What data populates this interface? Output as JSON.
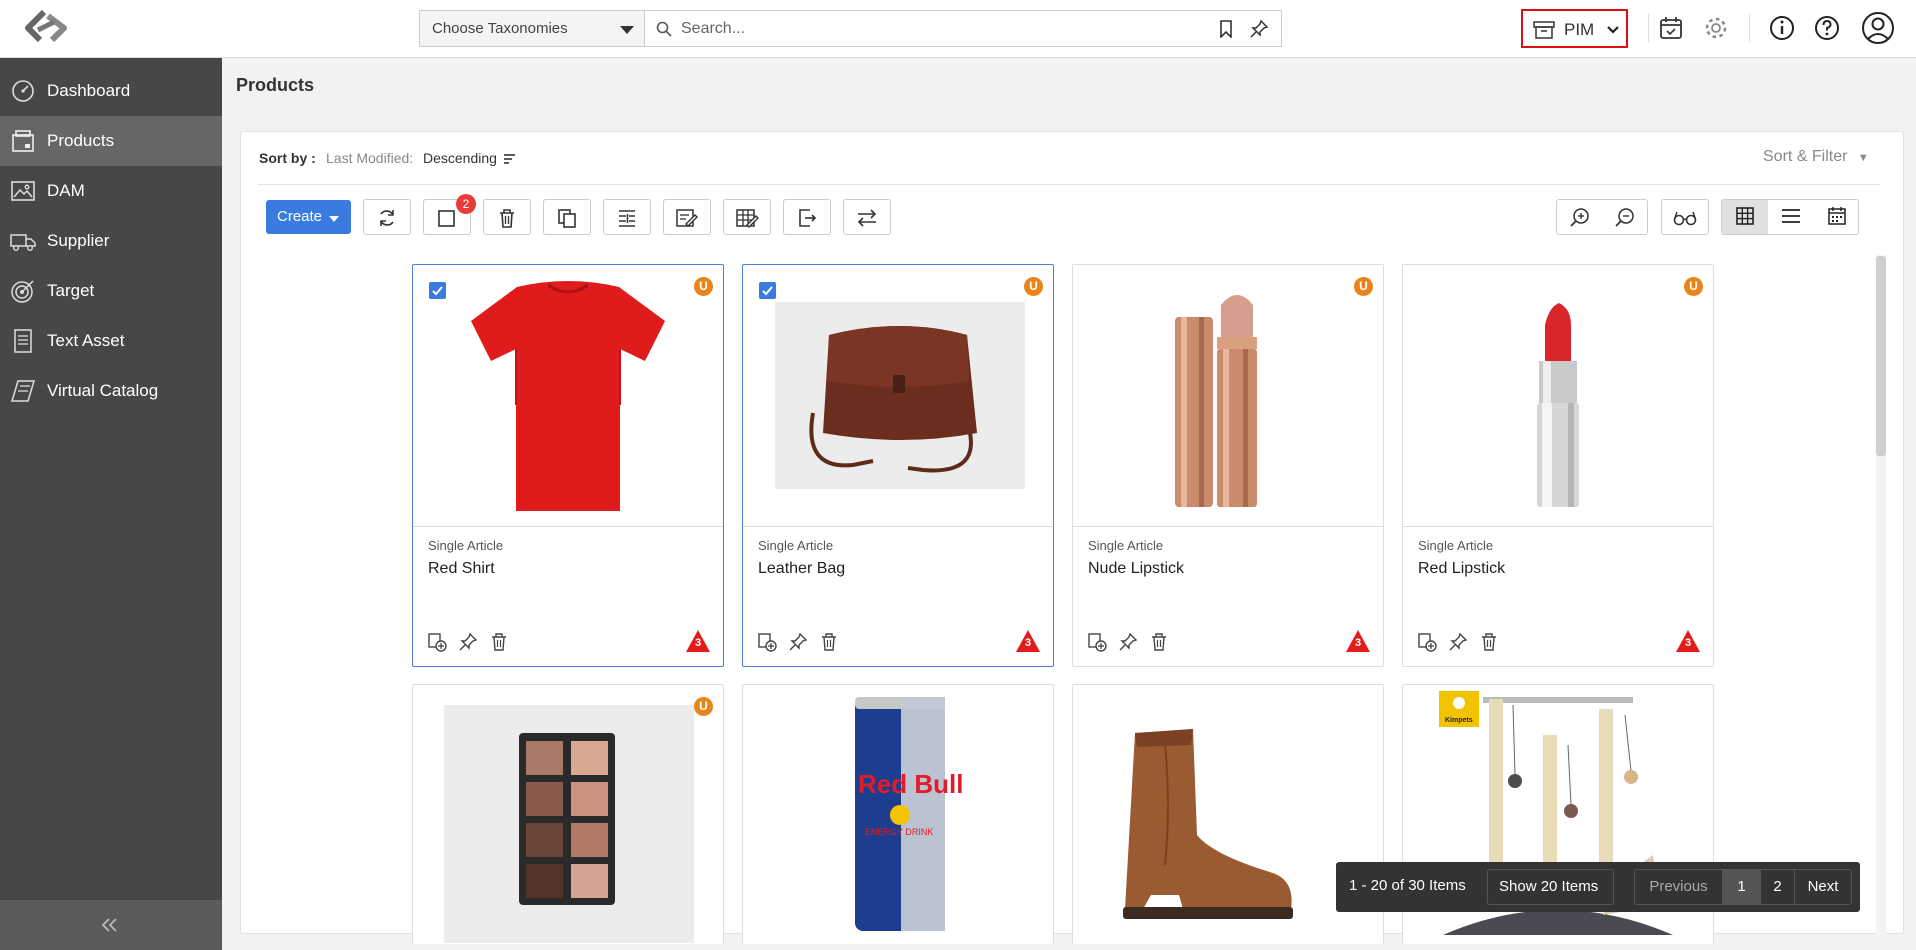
{
  "header": {
    "taxonomy_placeholder": "Choose Taxonomies",
    "search_placeholder": "Search...",
    "app_switcher_label": "PIM"
  },
  "sidebar": {
    "items": [
      {
        "label": "Dashboard",
        "icon": "dashboard-icon",
        "active": false
      },
      {
        "label": "Products",
        "icon": "products-icon",
        "active": true
      },
      {
        "label": "DAM",
        "icon": "image-icon",
        "active": false
      },
      {
        "label": "Supplier",
        "icon": "truck-icon",
        "active": false
      },
      {
        "label": "Target",
        "icon": "target-icon",
        "active": false
      },
      {
        "label": "Text Asset",
        "icon": "document-icon",
        "active": false
      },
      {
        "label": "Virtual Catalog",
        "icon": "catalog-icon",
        "active": false
      }
    ]
  },
  "page": {
    "title": "Products"
  },
  "sort": {
    "label": "Sort by :",
    "field": "Last Modified:",
    "value": "Descending",
    "filter_label": "Sort & Filter"
  },
  "toolbar": {
    "create_label": "Create",
    "selection_count": "2"
  },
  "products": [
    {
      "type": "Single Article",
      "name": "Red Shirt",
      "selected": true,
      "badge": "U",
      "warnings": "3"
    },
    {
      "type": "Single Article",
      "name": "Leather Bag",
      "selected": true,
      "badge": "U",
      "warnings": "3"
    },
    {
      "type": "Single Article",
      "name": "Nude Lipstick",
      "selected": false,
      "badge": "U",
      "warnings": "3"
    },
    {
      "type": "Single Article",
      "name": "Red Lipstick",
      "selected": false,
      "badge": "U",
      "warnings": "3"
    },
    {
      "type": "",
      "name": "",
      "selected": false,
      "badge": "U",
      "warnings": ""
    },
    {
      "type": "",
      "name": "",
      "selected": false,
      "badge": "",
      "warnings": ""
    },
    {
      "type": "",
      "name": "",
      "selected": false,
      "badge": "",
      "warnings": ""
    },
    {
      "type": "",
      "name": "",
      "selected": false,
      "badge": "",
      "warnings": ""
    }
  ],
  "images": {
    "can_text": "Red Bull",
    "can_subtext": "ENERGY DRINK",
    "brand_badge": "Kimpets"
  },
  "pagination": {
    "range": "1 - 20 of 30 Items",
    "show_label": "Show 20 Items",
    "previous": "Previous",
    "page1": "1",
    "page2": "2",
    "next": "Next"
  }
}
